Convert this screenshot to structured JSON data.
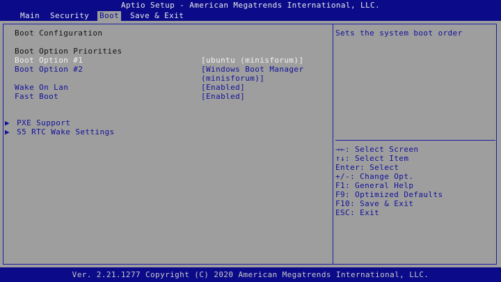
{
  "title": "Aptio Setup - American Megatrends International, LLC.",
  "menu": {
    "tabs": [
      {
        "label": "Main"
      },
      {
        "label": "Security"
      },
      {
        "label": "Boot"
      },
      {
        "label": "Save & Exit"
      }
    ],
    "active_tab": "Boot"
  },
  "boot": {
    "section_title": "Boot Configuration",
    "priorities_heading": "Boot Option Priorities",
    "options": [
      {
        "label": "Boot Option #1",
        "value": "[ubuntu (minisforum)]"
      },
      {
        "label": "Boot Option #2",
        "value": "[Windows Boot Manager",
        "value_cont": "(minisforum)]"
      },
      {
        "label": "Wake On Lan",
        "value": "[Enabled]"
      },
      {
        "label": "Fast Boot",
        "value": "[Enabled]"
      }
    ],
    "submenus": [
      {
        "label": "PXE Support"
      },
      {
        "label": "S5 RTC Wake Settings"
      }
    ]
  },
  "help": {
    "description": "Sets the system boot order",
    "keys": [
      "→←: Select Screen",
      "↑↓: Select Item",
      "Enter: Select",
      "+/-: Change Opt.",
      "F1: General Help",
      "F9: Optimized Defaults",
      "F10: Save & Exit",
      "ESC: Exit"
    ]
  },
  "footer": "Ver. 2.21.1277 Copyright (C) 2020 American Megatrends International, LLC.",
  "colors": {
    "frame_blue": "#0b0b8a",
    "panel_gray": "#9e9e9e",
    "highlight_white": "#f2f2f2",
    "item_blue": "#10109a"
  }
}
